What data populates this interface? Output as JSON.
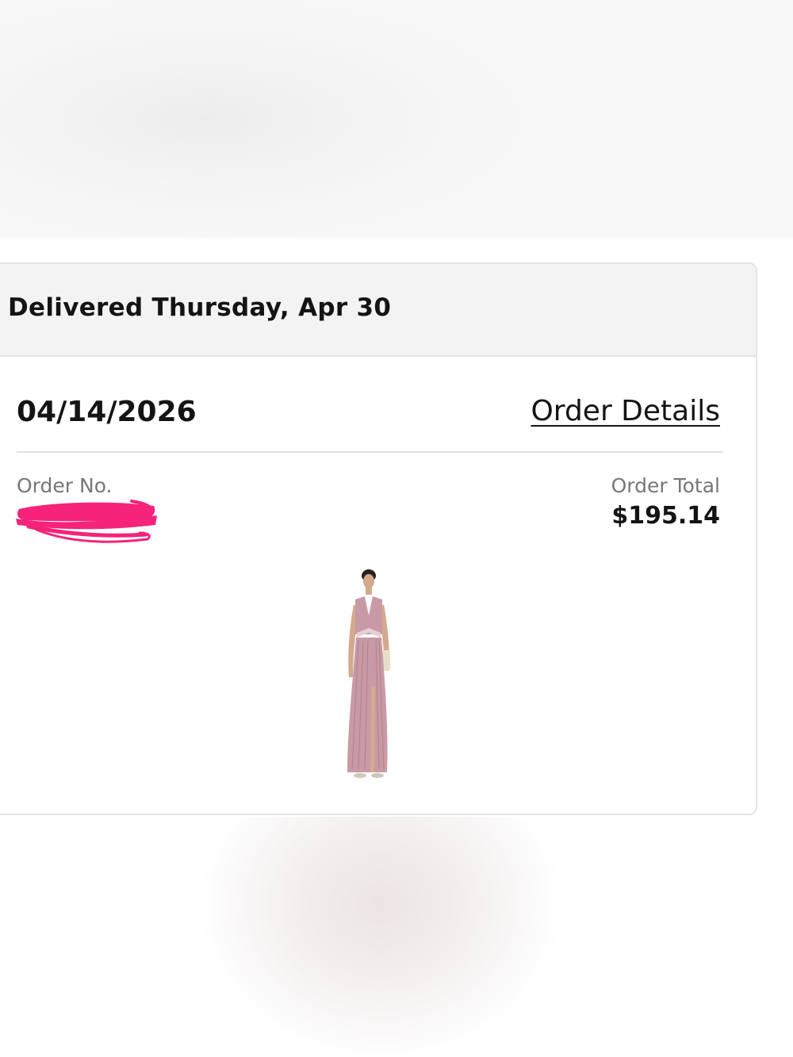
{
  "order": {
    "delivery_status": "Delivered Thursday, Apr 30",
    "order_date": "04/14/2026",
    "order_details_link": "Order Details",
    "order_no_label": "Order No.",
    "order_total_label": "Order Total",
    "order_total_value": "$195.14"
  },
  "product": {
    "image": "pink-maxi-dress-photo",
    "dress_color": "#c89aa5"
  },
  "colors": {
    "header_bg": "#f3f3f3",
    "redaction": "#f5237a",
    "text": "#141414",
    "muted_text": "#777777"
  }
}
